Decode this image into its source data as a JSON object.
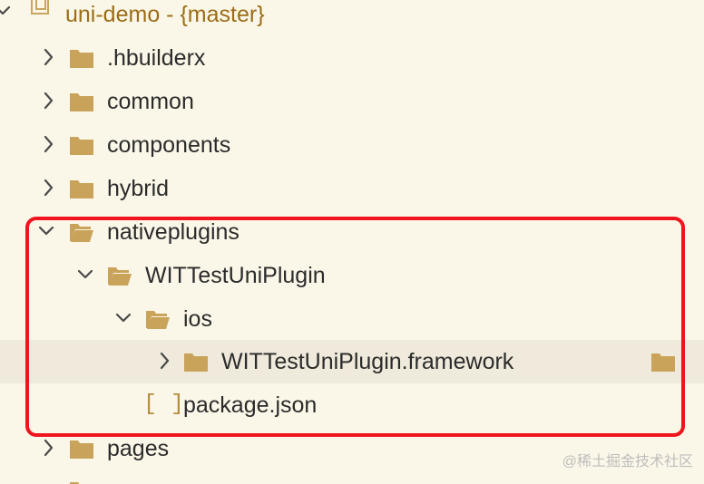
{
  "tree": {
    "root": {
      "label": "uni-demo - {master}",
      "expanded": true
    },
    "items": [
      {
        "label": ".hbuilderx",
        "type": "folder",
        "expanded": false
      },
      {
        "label": "common",
        "type": "folder",
        "expanded": false
      },
      {
        "label": "components",
        "type": "folder",
        "expanded": false
      },
      {
        "label": "hybrid",
        "type": "folder",
        "expanded": false
      },
      {
        "label": "nativeplugins",
        "type": "folder",
        "expanded": true
      },
      {
        "label": "WITTestUniPlugin",
        "type": "folder",
        "expanded": true
      },
      {
        "label": "ios",
        "type": "folder",
        "expanded": true
      },
      {
        "label": "WITTestUniPlugin.framework",
        "type": "folder",
        "expanded": false,
        "selected": true
      },
      {
        "label": "package.json",
        "type": "file",
        "icon_text": "[ ]"
      },
      {
        "label": "pages",
        "type": "folder",
        "expanded": false
      }
    ]
  },
  "watermark": "@稀土掘金技术社区",
  "colors": {
    "background": "#fbf7e8",
    "selected_row": "#efeadb",
    "folder": "#c9a35a",
    "root_text": "#9b6d18",
    "highlight": "#f0141e"
  },
  "icons": {
    "expanded": "chevron-down-icon",
    "collapsed": "chevron-right-icon",
    "folder": "folder-icon",
    "open_folder": "folder-open-icon",
    "file": "json-file-icon"
  }
}
